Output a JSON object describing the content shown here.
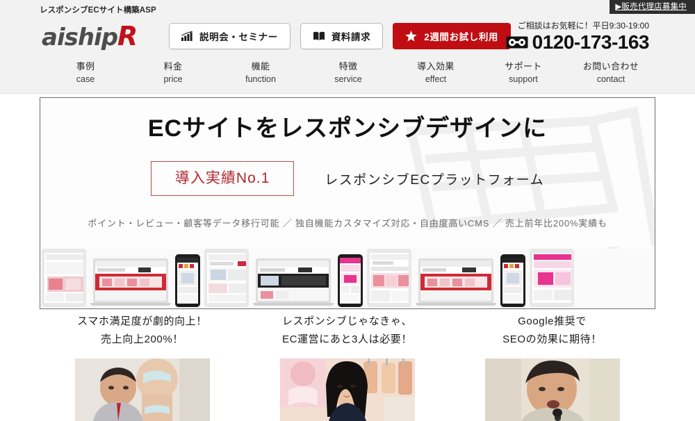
{
  "header": {
    "tagline": "レスポンシブECサイト構築ASP",
    "agency_banner": "▶販売代理店募集中",
    "logo_main": "aiship",
    "logo_accent": "R",
    "buttons": [
      {
        "label": "説明会・セミナー",
        "icon": "bar-chart-icon",
        "style": "outline"
      },
      {
        "label": "資料請求",
        "icon": "book-icon",
        "style": "outline"
      },
      {
        "label": "2週間お試し利用",
        "icon": "star-icon",
        "style": "primary"
      }
    ],
    "phone_note": "ご相談はお気軽に！平日9:30-19:00",
    "phone_number": "0120-173-163",
    "phone_icon": "free-dial-icon",
    "accent_color": "#bf0d12",
    "background_color": "#f2f2f2"
  },
  "nav": {
    "items": [
      {
        "ja": "事例",
        "en": "case"
      },
      {
        "ja": "料金",
        "en": "price"
      },
      {
        "ja": "機能",
        "en": "function"
      },
      {
        "ja": "特徴",
        "en": "service"
      },
      {
        "ja": "導入効果",
        "en": "effect"
      },
      {
        "ja": "サポート",
        "en": "support"
      },
      {
        "ja": "お問い合わせ",
        "en": "contact"
      }
    ]
  },
  "hero": {
    "title": "ECサイトをレスポンシブデザインに",
    "badge": "導入実績No.1",
    "subtitle": "レスポンシブECプラットフォーム",
    "features": "ポイント・レビュー・顧客等データ移行可能 ／ 独自機能カスタマイズ対応・自由度高いCMS ／ 売上前年比200%実績も",
    "badge_color": "#b0282d",
    "border_color": "#6e6e6e"
  },
  "columns": [
    {
      "line1": "スマホ満足度が劇的向上！",
      "line2": "売上向上200%！",
      "photo": "man-with-mannequin-photo"
    },
    {
      "line1": "レスポンシブじゃなきゃ、",
      "line2": "EC運営にあと3人は必要！",
      "photo": "woman-in-lingerie-shop-photo"
    },
    {
      "line1": "Google推奨で",
      "line2": "SEOの効果に期待！",
      "photo": "man-speaking-photo"
    }
  ],
  "devices": {
    "strip_label": "responsive-device-showcase",
    "items": [
      "tablet",
      "laptop",
      "phone",
      "tablet",
      "laptop",
      "phone",
      "tablet",
      "laptop",
      "phone",
      "tablet"
    ]
  }
}
